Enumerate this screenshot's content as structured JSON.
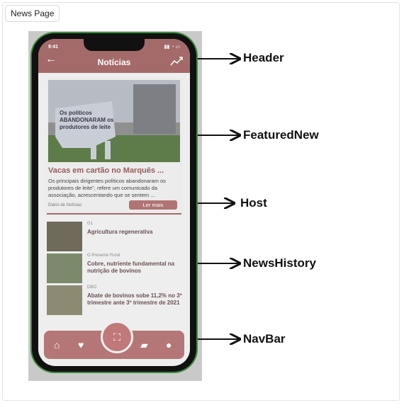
{
  "frame_tag": "News Page",
  "app": {
    "status_time": "9:41",
    "title": "Notícias",
    "featured": {
      "image_caption": "Os políticos ABANDONARAM os produtores de leite",
      "title": "Vacas em cartão no Marquês ...",
      "excerpt": "Os principais dirigentes políticos abandonaram os produtores de leite\", refere um comunicado da associação, acrescentando que se sentem ...",
      "source": "Diário de Notícias",
      "button": "Ler mais"
    },
    "history": [
      {
        "source": "G1",
        "title": "Agricultura regenerativa"
      },
      {
        "source": "O Presente Rural",
        "title": "Cobre, nutriente fundamental na nutrição de bovinos"
      },
      {
        "source": "DBO",
        "title": "Abate de bovinos sobe 11,2% no 3º trimestre ante 3º trimestre de 2021"
      }
    ],
    "navbar_icons": [
      "home-icon",
      "heart-icon",
      "scan-icon",
      "folder-icon",
      "person-icon"
    ]
  },
  "annotations": [
    "Header",
    "FeaturedNew",
    "Host",
    "NewsHistory",
    "NavBar"
  ],
  "colors": {
    "accent": "#a46a6a",
    "highlight": "#3a8a3a"
  }
}
